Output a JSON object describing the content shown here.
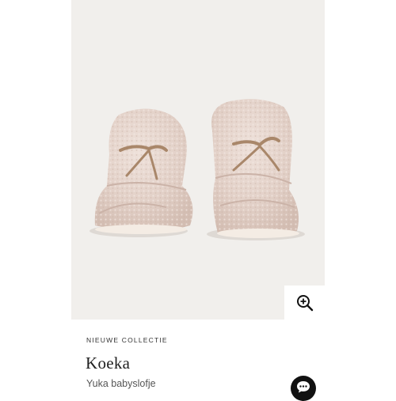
{
  "product": {
    "image_alt_icon": "baby-booties-photo",
    "label": "NIEUWE COLLECTIE",
    "brand": "Koeka",
    "name": "Yuka babyslofje"
  },
  "controls": {
    "zoom_icon": "zoom-in-icon",
    "chat_icon": "chat-bubble-icon"
  },
  "colors": {
    "image_background": "#f1efec",
    "bootie": "#e4d3cb",
    "lace": "#a9876a",
    "chat_button": "#111111"
  }
}
